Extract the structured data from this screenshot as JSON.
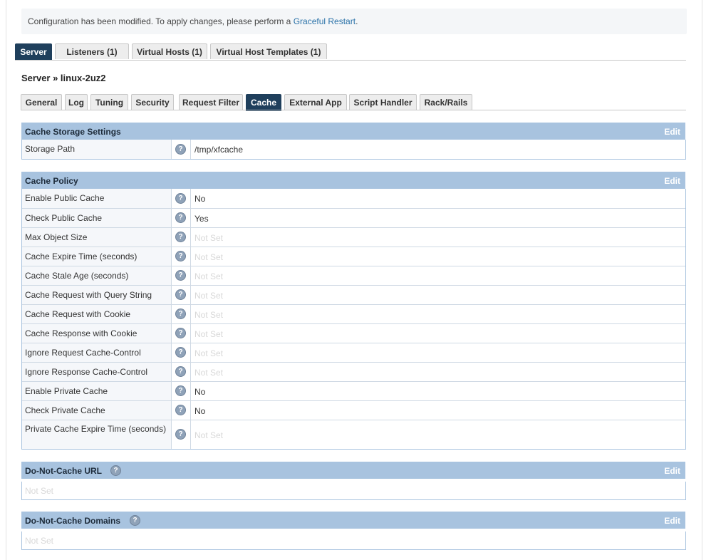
{
  "notice": {
    "text": "Configuration has been modified. To apply changes, please perform a ",
    "link": "Graceful Restart",
    "suffix": "."
  },
  "top_tabs": [
    {
      "label": "Server",
      "active": true
    },
    {
      "label": "Listeners (1)",
      "active": false
    },
    {
      "label": "Virtual Hosts (1)",
      "active": false
    },
    {
      "label": "Virtual Host Templates (1)",
      "active": false
    }
  ],
  "breadcrumb": "Server » linux-2uz2",
  "sub_tabs": [
    {
      "label": "General",
      "active": false
    },
    {
      "label": "Log",
      "active": false
    },
    {
      "label": "Tuning",
      "active": false
    },
    {
      "label": "Security",
      "active": false
    },
    {
      "label": "Request Filter",
      "active": false
    },
    {
      "label": "Cache",
      "active": true
    },
    {
      "label": "External App",
      "active": false
    },
    {
      "label": "Script Handler",
      "active": false
    },
    {
      "label": "Rack/Rails",
      "active": false
    }
  ],
  "help_glyph": "?",
  "storage": {
    "title": "Cache Storage Settings",
    "edit": "Edit",
    "rows": [
      {
        "label": "Storage Path",
        "value": "/tmp/xfcache",
        "not_set": false
      }
    ]
  },
  "policy": {
    "title": "Cache Policy",
    "edit": "Edit",
    "rows": [
      {
        "label": "Enable Public Cache",
        "value": "No",
        "not_set": false
      },
      {
        "label": "Check Public Cache",
        "value": "Yes",
        "not_set": false
      },
      {
        "label": "Max Object Size",
        "value": "Not Set",
        "not_set": true
      },
      {
        "label": "Cache Expire Time (seconds)",
        "value": "Not Set",
        "not_set": true
      },
      {
        "label": "Cache Stale Age (seconds)",
        "value": "Not Set",
        "not_set": true
      },
      {
        "label": "Cache Request with Query String",
        "value": "Not Set",
        "not_set": true
      },
      {
        "label": "Cache Request with Cookie",
        "value": "Not Set",
        "not_set": true
      },
      {
        "label": "Cache Response with Cookie",
        "value": "Not Set",
        "not_set": true
      },
      {
        "label": "Ignore Request Cache-Control",
        "value": "Not Set",
        "not_set": true
      },
      {
        "label": "Ignore Response Cache-Control",
        "value": "Not Set",
        "not_set": true
      },
      {
        "label": "Enable Private Cache",
        "value": "No",
        "not_set": false
      },
      {
        "label": "Check Private Cache",
        "value": "No",
        "not_set": false
      },
      {
        "label": "Private Cache Expire Time (seconds)",
        "value": "Not Set",
        "not_set": true
      }
    ]
  },
  "no_cache_url": {
    "title": "Do-Not-Cache URL",
    "edit": "Edit",
    "value": "Not Set"
  },
  "no_cache_domains": {
    "title": "Do-Not-Cache Domains",
    "edit": "Edit",
    "value": "Not Set"
  },
  "colors": {
    "header_bg": "#a8c3df",
    "active_tab": "#1f3f5c",
    "link": "#2a72a8",
    "help_icon": "#8fa2b8"
  },
  "icons": {
    "help": "help-icon"
  }
}
